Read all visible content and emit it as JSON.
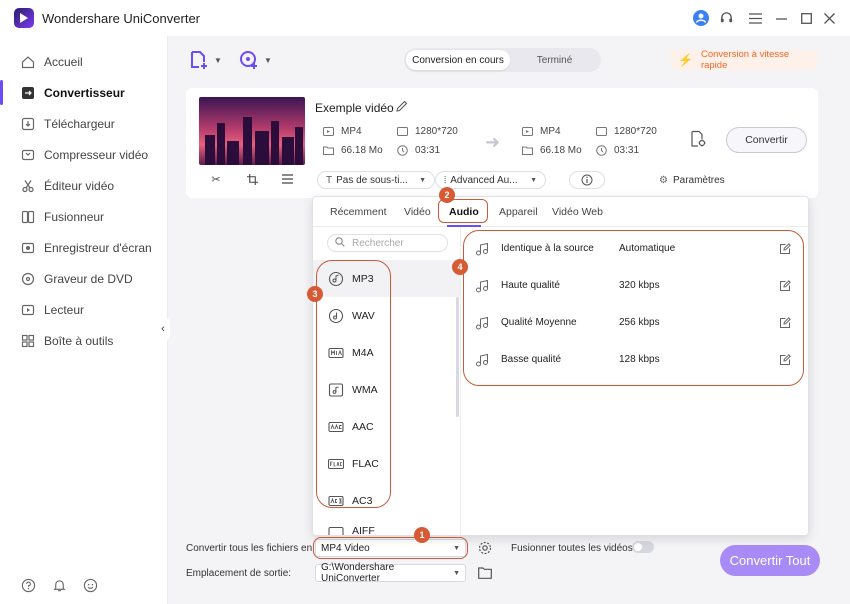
{
  "window": {
    "title": "Wondershare UniConverter"
  },
  "sidebar": {
    "items": [
      {
        "label": "Accueil",
        "icon": "home-icon"
      },
      {
        "label": "Convertisseur",
        "icon": "convert-icon"
      },
      {
        "label": "Téléchargeur",
        "icon": "download-icon"
      },
      {
        "label": "Compresseur vidéo",
        "icon": "compress-icon"
      },
      {
        "label": "Éditeur vidéo",
        "icon": "scissors-icon"
      },
      {
        "label": "Fusionneur",
        "icon": "merge-icon"
      },
      {
        "label": "Enregistreur d'écran",
        "icon": "record-icon"
      },
      {
        "label": "Graveur de DVD",
        "icon": "disc-icon"
      },
      {
        "label": "Lecteur",
        "icon": "play-icon"
      },
      {
        "label": "Boîte à outils",
        "icon": "toolbox-icon"
      }
    ],
    "active": "Convertisseur"
  },
  "header": {
    "tabs": [
      "Conversion en cours",
      "Terminé"
    ],
    "active_tab": "Conversion en cours",
    "speed_label": "Conversion à vitesse rapide"
  },
  "file": {
    "title": "Exemple vidéo",
    "source": {
      "format": "MP4",
      "resolution": "1280*720",
      "size": "66.18 Mo",
      "duration": "03:31"
    },
    "target": {
      "format": "MP4",
      "resolution": "1280*720",
      "size": "66.18 Mo",
      "duration": "03:31"
    },
    "convert_label": "Convertir",
    "subtitle_dropdown": "Pas de sous-ti...",
    "audio_dropdown": "Advanced Au...",
    "settings_label": "Paramètres"
  },
  "format_panel": {
    "tabs": [
      "Récemment",
      "Vidéo",
      "Audio",
      "Appareil",
      "Vidéo Web"
    ],
    "active_tab": "Audio",
    "search_placeholder": "Rechercher",
    "formats": [
      "MP3",
      "WAV",
      "M4A",
      "WMA",
      "AAC",
      "FLAC",
      "AC3",
      "AIFF"
    ],
    "selected_format": "MP3",
    "qualities": [
      {
        "name": "Identique à la source",
        "value": "Automatique"
      },
      {
        "name": "Haute qualité",
        "value": "320 kbps"
      },
      {
        "name": "Qualité Moyenne",
        "value": "256 kbps"
      },
      {
        "name": "Basse qualité",
        "value": "128 kbps"
      }
    ]
  },
  "bottom": {
    "convert_all_label": "Convertir tous les fichiers en:",
    "convert_all_value": "MP4 Video",
    "merge_label": "Fusionner toutes les vidéos",
    "merge_enabled": false,
    "output_label": "Emplacement de sortie:",
    "output_value": "G:\\Wondershare UniConverter",
    "convert_all_button": "Convertir Tout"
  },
  "annotations": [
    "1",
    "2",
    "3",
    "4"
  ],
  "colors": {
    "accent": "#6c4cf5",
    "annotation": "#d75a35",
    "speed": "#f0682b",
    "convert_all": "#a88bf7"
  }
}
